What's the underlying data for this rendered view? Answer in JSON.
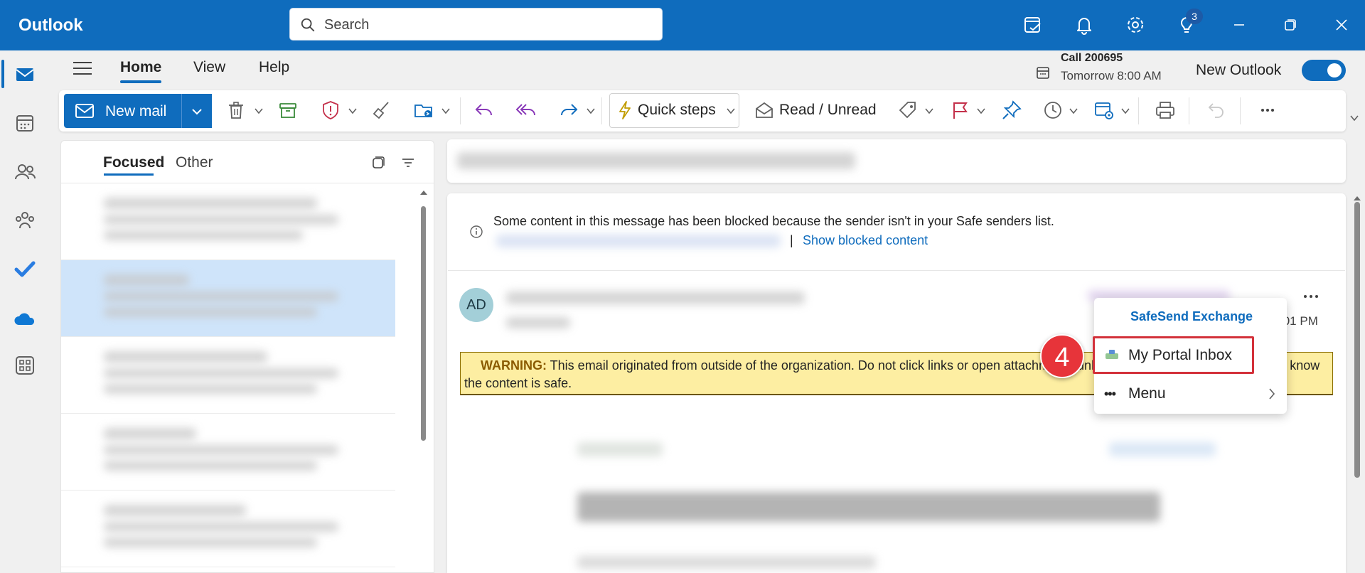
{
  "app": {
    "title": "Outlook"
  },
  "search": {
    "placeholder": "Search"
  },
  "titlebar": {
    "notification_badge": "3",
    "icons": [
      "my-day-icon",
      "bell-icon",
      "gear-icon",
      "lightbulb-icon",
      "minimize-icon",
      "restore-icon",
      "close-icon"
    ]
  },
  "ribbon": {
    "tabs": [
      {
        "label": "Home",
        "active": true
      },
      {
        "label": "View",
        "active": false
      },
      {
        "label": "Help",
        "active": false
      }
    ],
    "upcoming": {
      "title": "Call 200695",
      "time": "Tomorrow 8:00 AM"
    },
    "new_outlook_label": "New Outlook",
    "new_outlook_enabled": true
  },
  "toolbar": {
    "new_mail_label": "New mail",
    "quick_steps_label": "Quick steps",
    "read_unread_label": "Read / Unread"
  },
  "message_list": {
    "tabs": [
      {
        "label": "Focused",
        "active": true
      },
      {
        "label": "Other",
        "active": false
      }
    ]
  },
  "reading_pane": {
    "blocked_notice": "Some content in this message has been blocked because the sender isn't in your Safe senders list.",
    "show_blocked_link": "Show blocked content",
    "pipe": "|",
    "sender_initials": "AD",
    "time_partial": ":01 PM",
    "warning": {
      "label": "WARNING:",
      "text": " This email originated from outside of the organization. Do not click links or open attachments unless you recognize the sender and know the content is safe."
    }
  },
  "addin_popup": {
    "title": "SafeSend Exchange",
    "items": [
      {
        "label": "My Portal Inbox",
        "highlighted": true
      },
      {
        "label": "Menu",
        "has_submenu": true
      }
    ]
  },
  "annotation": {
    "step_number": "4"
  },
  "colors": {
    "brand_blue": "#0f6cbd",
    "warning_bg": "#fdeea2",
    "highlight_red": "#d3313a",
    "step_badge_red": "#e7343a",
    "selected_row": "#cfe4fa"
  }
}
